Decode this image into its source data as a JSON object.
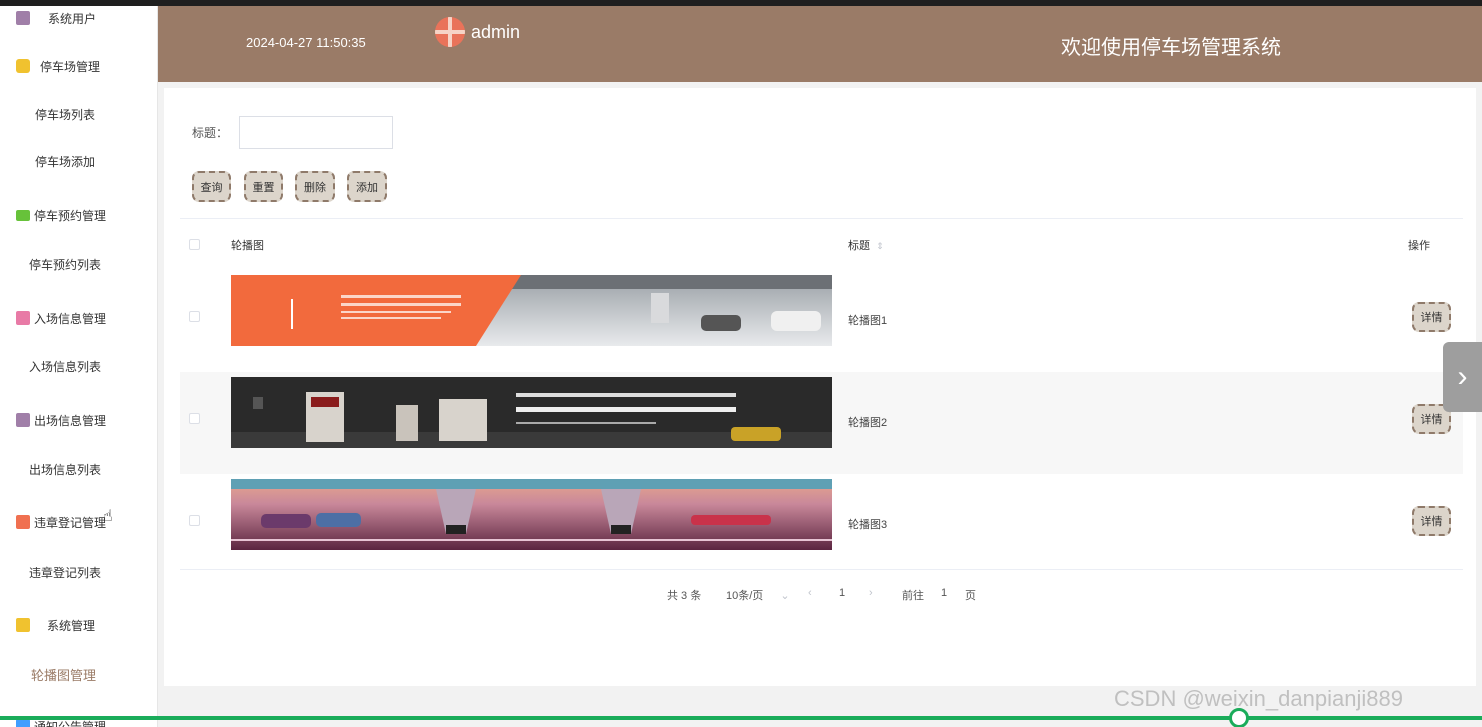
{
  "header": {
    "datetime": "2024-04-27 11:50:35",
    "username": "admin",
    "welcome": "欢迎使用停车场管理系统"
  },
  "sidebar": {
    "items": [
      {
        "label": "系统用户",
        "icon": "user-icon",
        "color": "#a07fa8"
      },
      {
        "label": "停车场管理",
        "icon": "cube-icon",
        "color": "#f0c22f"
      },
      {
        "label": "停车场列表"
      },
      {
        "label": "停车场添加"
      },
      {
        "label": "停车预约管理",
        "icon": "chat-icon",
        "color": "#67c23a"
      },
      {
        "label": "停车预约列表"
      },
      {
        "label": "入场信息管理",
        "icon": "badge-icon",
        "color": "#e87aa6"
      },
      {
        "label": "入场信息列表"
      },
      {
        "label": "出场信息管理",
        "icon": "user-icon",
        "color": "#a07fa8"
      },
      {
        "label": "出场信息列表"
      },
      {
        "label": "违章登记管理",
        "icon": "grid-icon",
        "color": "#f07050"
      },
      {
        "label": "违章登记列表"
      },
      {
        "label": "系统管理",
        "icon": "cube-icon",
        "color": "#f0c22f"
      },
      {
        "label": "轮播图管理"
      },
      {
        "label": "通知公告管理",
        "icon": "star-icon",
        "color": "#409eff"
      }
    ]
  },
  "filter": {
    "label": "标题：",
    "placeholder": "",
    "buttons": [
      "查询",
      "重置",
      "删除",
      "添加"
    ]
  },
  "table": {
    "headers": [
      "轮播图",
      "标题",
      "操作"
    ],
    "rows": [
      {
        "title": "轮播图1",
        "action": "详情",
        "banner": {
          "top_text": "一全九鼎",
          "bg": "#f26a3d"
        }
      },
      {
        "title": "轮播图2",
        "action": "详情",
        "banner": {
          "heading": "停车王",
          "subheading": "共享车位 自动付费",
          "bg": "#2a2a2a"
        }
      },
      {
        "title": "轮播图3",
        "action": "详情",
        "banner": {
          "bg": "#8a2e55"
        }
      }
    ]
  },
  "pagination": {
    "total": "共 3 条",
    "page_size": "10条/页",
    "current": "1",
    "goto_label": "前往",
    "goto_value": "1",
    "page_suffix": "页"
  },
  "watermark": "CSDN @weixin_danpianji889"
}
